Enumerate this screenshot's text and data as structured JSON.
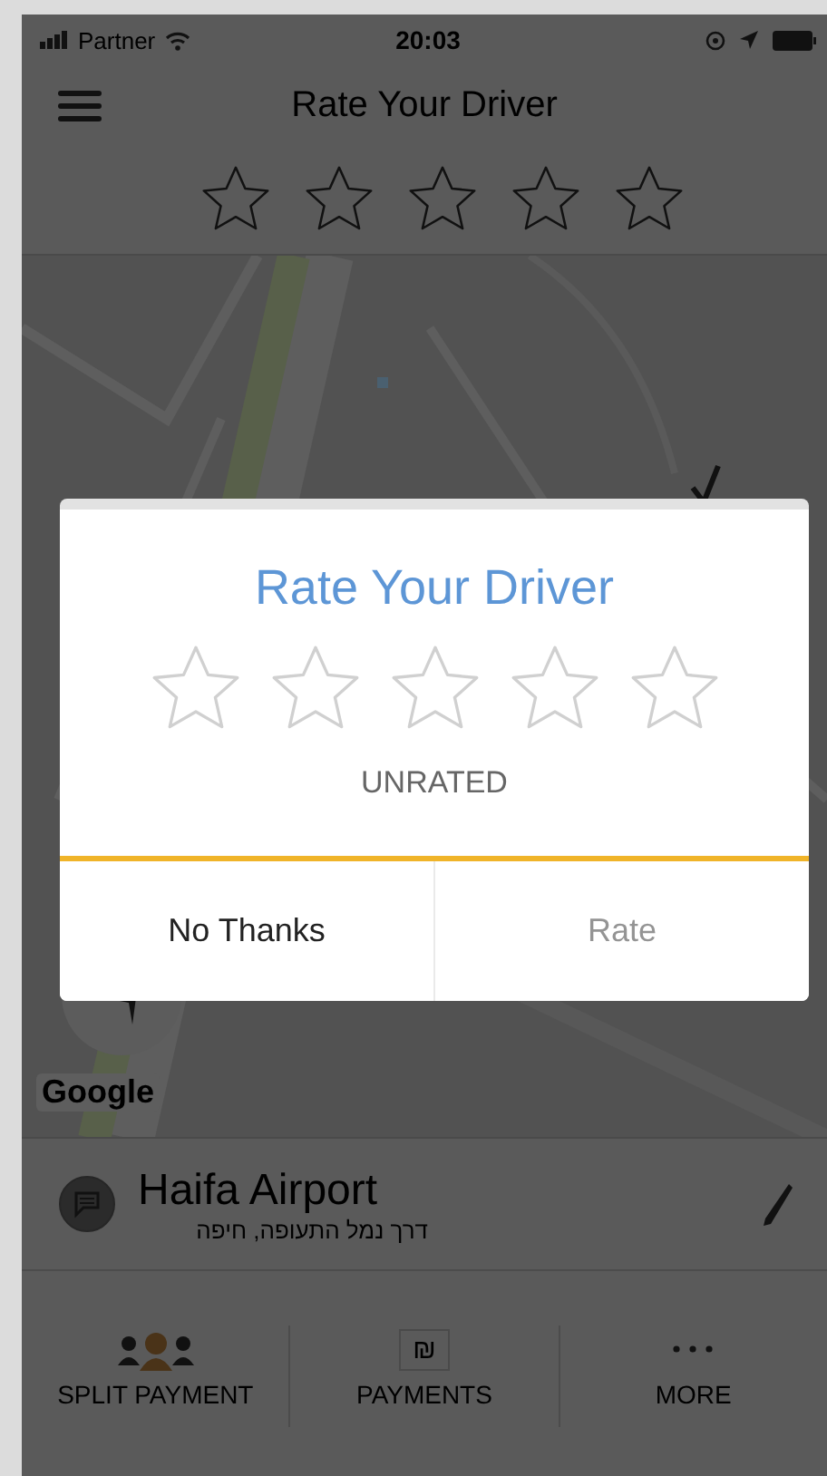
{
  "status_bar": {
    "carrier": "Partner",
    "time": "20:03"
  },
  "nav": {
    "title": "Rate Your Driver",
    "stars": 0
  },
  "map": {
    "attribution": "Google"
  },
  "destination": {
    "name": "Haifa Airport",
    "address": "דרך נמל התעופה, חיפה"
  },
  "bottom_tabs": [
    {
      "label": "SPLIT PAYMENT",
      "kind": "split"
    },
    {
      "label": "PAYMENTS",
      "kind": "payments",
      "icon_glyph": "₪"
    },
    {
      "label": "MORE",
      "kind": "more"
    }
  ],
  "dialog": {
    "title": "Rate Your Driver",
    "stars": 0,
    "rating_label": "UNRATED",
    "buttons": [
      {
        "label": "No Thanks",
        "disabled": false
      },
      {
        "label": "Rate",
        "disabled": true
      }
    ]
  }
}
